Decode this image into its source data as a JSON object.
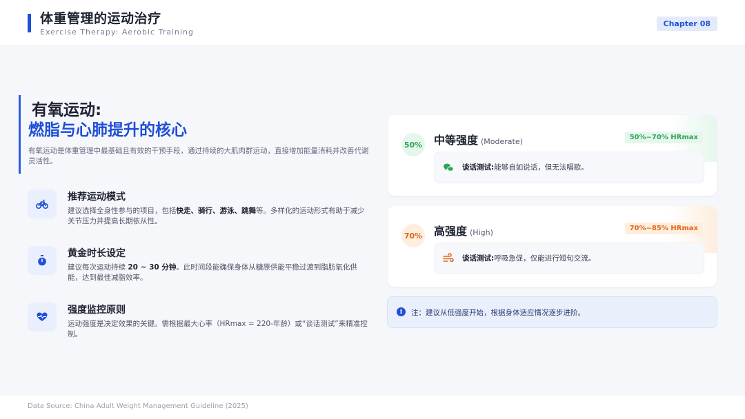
{
  "header": {
    "title": "体重管理的运动治疗",
    "subtitle": "Exercise Therapy: Aerobic Training",
    "chapter": "Chapter 08"
  },
  "intro": {
    "heading_line1": "有氧运动:",
    "heading_line2": "燃脂与心肺提升的核心",
    "description": "有氧运动是体重管理中最基础且有效的干预手段，通过持续的大肌肉群运动，直接增加能量消耗并改善代谢灵活性。"
  },
  "features": [
    {
      "icon": "bicycle-icon",
      "title": "推荐运动模式",
      "text_pre": "建议选择全身性参与的项目，包括",
      "text_bold": "快走、骑行、游泳、跳舞",
      "text_post": "等。多样化的运动形式有助于减少关节压力并提高长期依从性。"
    },
    {
      "icon": "stopwatch-icon",
      "title": "黄金时长设定",
      "text_pre": "建议每次运动持续 ",
      "text_bold": "20 ~ 30 分钟",
      "text_post": "。此时间段能确保身体从糖原供能平稳过渡到脂肪氧化供能，达到最佳减脂效率。"
    },
    {
      "icon": "heartbeat-icon",
      "title": "强度监控原则",
      "text_pre": "运动强度是决定效果的关键。需根据最大心率（HRmax = 220-年龄）或“谈话测试”来精准控制。",
      "text_bold": "",
      "text_post": ""
    }
  ],
  "intensity_cards": [
    {
      "percent": "50%",
      "title": "中等强度",
      "title_en": "(Moderate)",
      "hr_range": "50%~70% HRmax",
      "talk_icon": "chat-bubbles-icon",
      "talk_label": "谈话测试:",
      "talk_text": "能够自如说话，但无法唱歌。",
      "color": "#2aa657",
      "bg": "#e6f6ec"
    },
    {
      "percent": "70%",
      "title": "高强度",
      "title_en": "(High)",
      "hr_range": "70%~85% HRmax",
      "talk_icon": "wind-icon",
      "talk_label": "谈话测试:",
      "talk_text": "呼吸急促，仅能进行短句交流。",
      "color": "#e0661c",
      "bg": "#fdeede"
    }
  ],
  "note": {
    "icon": "info-icon",
    "text": "注：建议从低强度开始，根据身体适应情况逐步进阶。"
  },
  "footer": {
    "source": "Data Source: China Adult Weight Management Guideline (2025)"
  }
}
